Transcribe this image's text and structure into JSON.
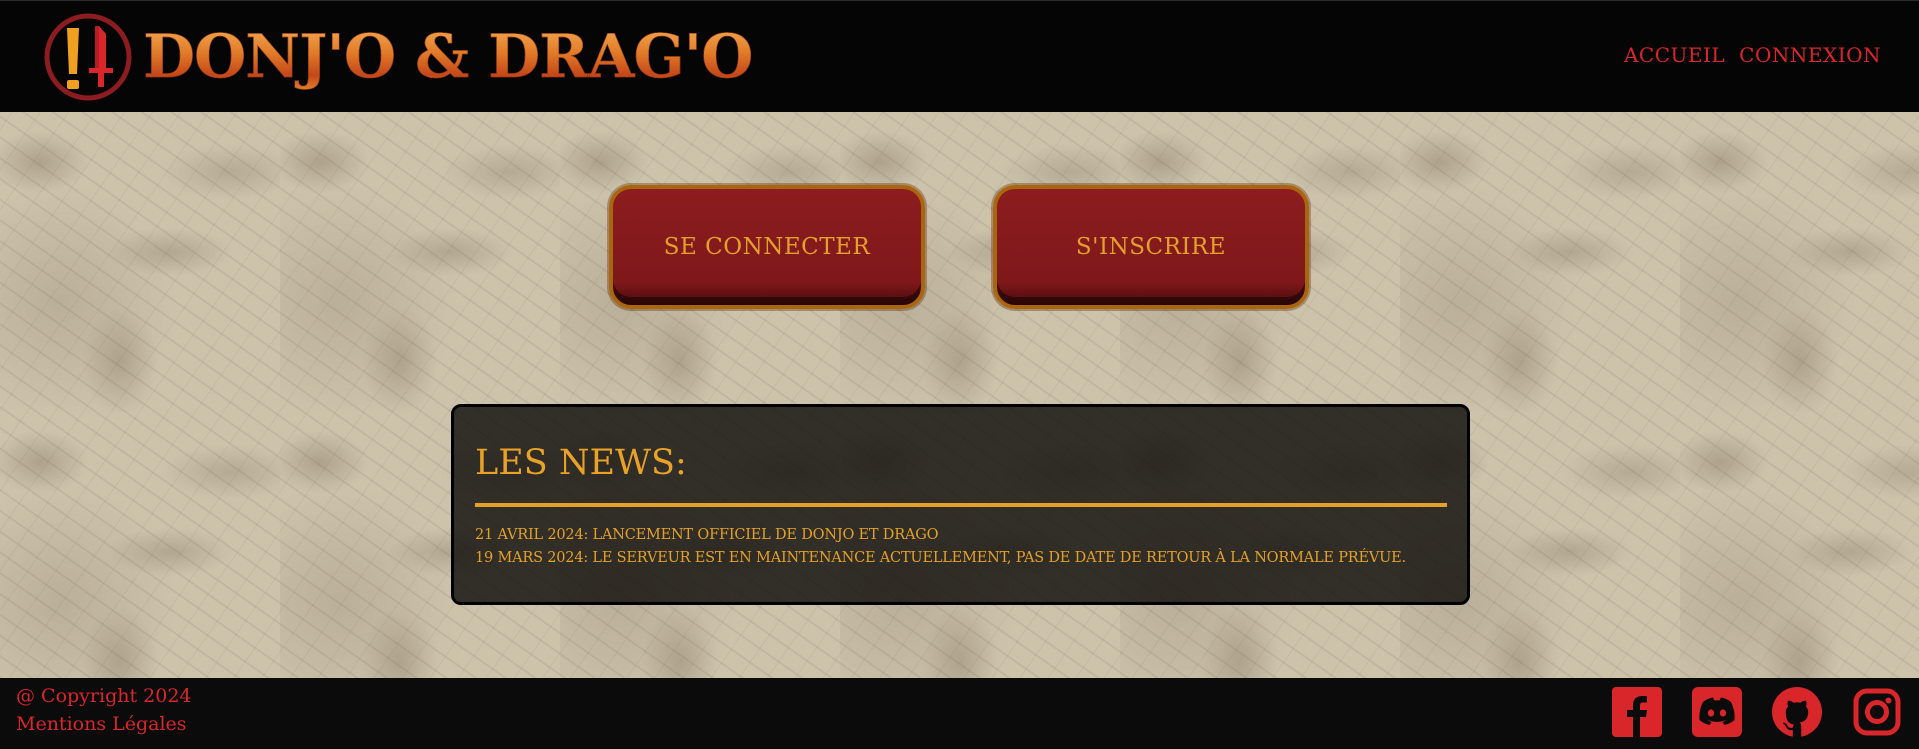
{
  "brand": {
    "name": "DONJ'O & DRAG'O",
    "logo_icon": "sword-shield-emblem-icon"
  },
  "nav": {
    "items": [
      {
        "label": "ACCUEIL"
      },
      {
        "label": "CONNEXION"
      }
    ]
  },
  "actions": {
    "login_label": "SE CONNECTER",
    "signup_label": "S'INSCRIRE"
  },
  "news": {
    "title": "LES NEWS:",
    "items": [
      {
        "text": "21 AVRIL 2024: LANCEMENT OFFICIEL DE DONJO ET DRAGO"
      },
      {
        "text": "19 MARS 2024: LE SERVEUR EST EN MAINTENANCE ACTUELLEMENT, PAS DE DATE DE RETOUR À LA NORMALE PRÉVUE."
      }
    ]
  },
  "footer": {
    "copyright": "@ Copyright 2024",
    "legal": "Mentions Légales",
    "socials": [
      "facebook-icon",
      "discord-icon",
      "github-icon",
      "instagram-icon"
    ]
  },
  "colors": {
    "accent_red": "#d9262b",
    "gold": "#e3a129",
    "button_red": "#7f181a",
    "header_bg": "#050505",
    "parchment": "#cdc3ab"
  }
}
